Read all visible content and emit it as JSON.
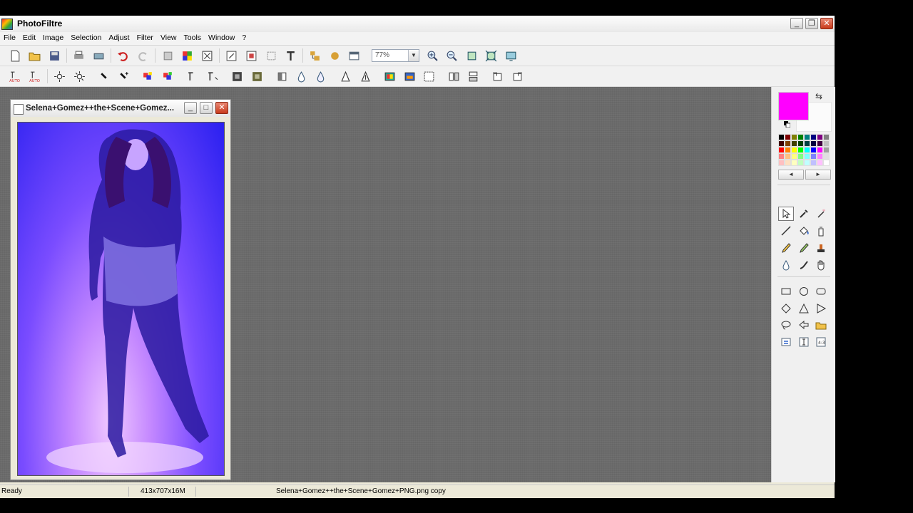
{
  "window": {
    "title": "PhotoFiltre",
    "minimize": "_",
    "restore": "❐",
    "close": "✕"
  },
  "menu": [
    "File",
    "Edit",
    "Image",
    "Selection",
    "Adjust",
    "Filter",
    "View",
    "Tools",
    "Window",
    "?"
  ],
  "toolbar": {
    "zoom_value": "77%",
    "zoom_arrow": "▼"
  },
  "document": {
    "title": "Selena+Gomez++the+Scene+Gomez...",
    "minimize": "_",
    "maximize": "□",
    "close": "✕"
  },
  "palette": {
    "foreground": "#ff00ff",
    "background": "#fbfbfb",
    "swap_glyph": "⇆",
    "prev": "◄",
    "next": "►",
    "colors": [
      "#000000",
      "#800000",
      "#808000",
      "#008000",
      "#008080",
      "#000080",
      "#800080",
      "#808080",
      "#400000",
      "#804000",
      "#404000",
      "#004000",
      "#004040",
      "#000040",
      "#400040",
      "#c0c0c0",
      "#ff0000",
      "#ff8000",
      "#ffff00",
      "#00ff00",
      "#00ffff",
      "#0000ff",
      "#ff00ff",
      "#a0a0a0",
      "#ff8080",
      "#ffc080",
      "#ffff80",
      "#80ff80",
      "#80ffff",
      "#8080ff",
      "#ff80ff",
      "#e0e0e0",
      "#ffc0c0",
      "#ffe0c0",
      "#ffffc0",
      "#c0ffc0",
      "#c0ffff",
      "#c0c0ff",
      "#ffc0ff",
      "#ffffff"
    ]
  },
  "status": {
    "state": "Ready",
    "dimensions": "413x707x16M",
    "filename": "Selena+Gomez++the+Scene+Gomez+PNG.png copy"
  }
}
